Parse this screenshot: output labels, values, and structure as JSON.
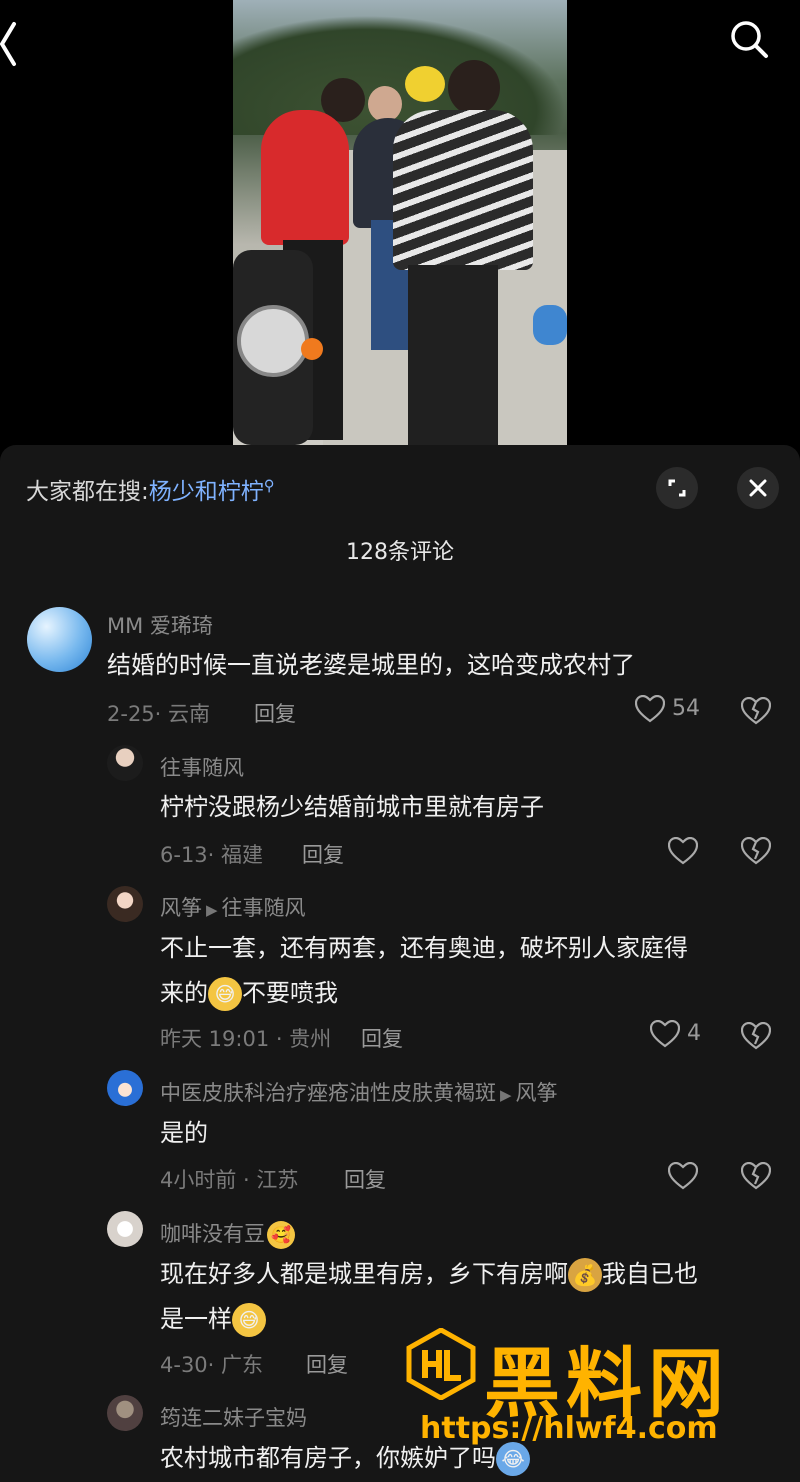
{
  "topbar": {
    "back_icon": "chevron-left-icon",
    "search_icon": "search-icon"
  },
  "video": {
    "description_icon": "video-thumbnail"
  },
  "panel": {
    "hot_search_prefix": "大家都在搜:",
    "hot_search_keyword": "杨少和柠柠",
    "comment_count": "128条评论"
  },
  "comments": [
    {
      "user": "MM 爱琋琦",
      "text": "结婚的时候一直说老婆是城里的，这哈变成农村了",
      "meta": "2-25· 云南",
      "reply": "回复",
      "likes": "54"
    },
    {
      "user": "往事随风",
      "text": "柠柠没跟杨少结婚前城市里就有房子",
      "meta": "6-13· 福建",
      "reply": "回复",
      "likes": ""
    },
    {
      "user": "风筝",
      "reply_to": "往事随风",
      "text_line1": "不止一套，还有两套，还有奥迪，破坏别人家庭得",
      "text_line2a": "来的",
      "text_line2b": "不要喷我",
      "meta": "昨天 19:01 · 贵州",
      "reply": "回复",
      "likes": "4"
    },
    {
      "user": "中医皮肤科治疗痤疮油性皮肤黄褐斑",
      "reply_to": "风筝",
      "text": "是的",
      "meta": "4小时前 · 江苏",
      "reply": "回复",
      "likes": ""
    },
    {
      "user": "咖啡没有豆",
      "text_line1": "现在好多人都是城里有房，乡下有房啊",
      "text_line1b": "我自已也",
      "text_line2": "是一样",
      "meta": "4-30· 广东",
      "reply": "回复",
      "likes": ""
    },
    {
      "user": "筠连二妹子宝妈",
      "text": "农村城市都有房子，你嫉妒了吗"
    }
  ],
  "watermark": {
    "title": "黑料网",
    "url": "https://hlwf4.com",
    "logo": "HL"
  },
  "colors": {
    "keyword": "#7fb2ff",
    "watermark": "#ffb300",
    "panel": "#161616"
  }
}
